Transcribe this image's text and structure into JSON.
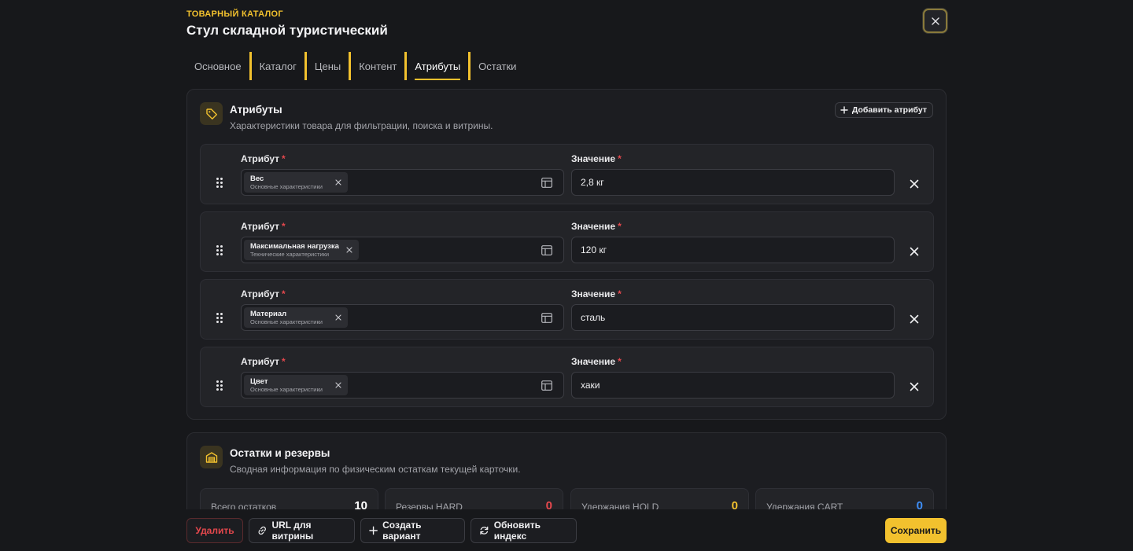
{
  "header": {
    "eyebrow": "ТОВАРНЫЙ КАТАЛОГ",
    "title": "Стул складной туристический"
  },
  "tabs": [
    {
      "label": "Основное",
      "active": false
    },
    {
      "label": "Каталог",
      "active": false
    },
    {
      "label": "Цены",
      "active": false
    },
    {
      "label": "Контент",
      "active": false
    },
    {
      "label": "Атрибуты",
      "active": true
    },
    {
      "label": "Остатки",
      "active": false
    }
  ],
  "attributes_card": {
    "title": "Атрибуты",
    "subtitle": "Характеристики товара для фильтрации, поиска и витрины.",
    "add_button": "Добавить атрибут",
    "attribute_label": "Атрибут",
    "value_label": "Значение",
    "required_mark": "*",
    "rows": [
      {
        "name": "Вес",
        "category": "Основные характеристики",
        "value": "2,8 кг"
      },
      {
        "name": "Максимальная нагрузка",
        "category": "Технические характеристики",
        "value": "120 кг"
      },
      {
        "name": "Материал",
        "category": "Основные характеристики",
        "value": "сталь"
      },
      {
        "name": "Цвет",
        "category": "Основные характеристики",
        "value": "хаки"
      }
    ]
  },
  "stock_card": {
    "title": "Остатки и резервы",
    "subtitle": "Сводная информация по физическим остаткам текущей карточки.",
    "stats": [
      {
        "label": "Всего остатков",
        "value": "10",
        "color": "#ffffff"
      },
      {
        "label": "Резервы HARD",
        "value": "0",
        "color": "#e5484d"
      },
      {
        "label": "Удержания HOLD",
        "value": "0",
        "color": "#f2c12e"
      },
      {
        "label": "Удержания CART",
        "value": "0",
        "color": "#3e8ef7"
      }
    ]
  },
  "footer": {
    "delete": "Удалить",
    "storefront_url": "URL для витрины",
    "create_variant": "Создать вариант",
    "refresh_index": "Обновить индекс",
    "save": "Сохранить"
  },
  "colors": {
    "accent": "#f2c12e",
    "danger": "#e5484d",
    "background": "#17181b",
    "card": "#1c1d21"
  },
  "icons": {
    "close": "close-icon",
    "tag": "tag-icon",
    "plus": "plus-icon",
    "drag": "drag-handle-icon",
    "remove": "remove-icon",
    "browse": "layout-icon",
    "warehouse": "warehouse-icon",
    "link": "link-icon",
    "refresh": "refresh-icon"
  }
}
